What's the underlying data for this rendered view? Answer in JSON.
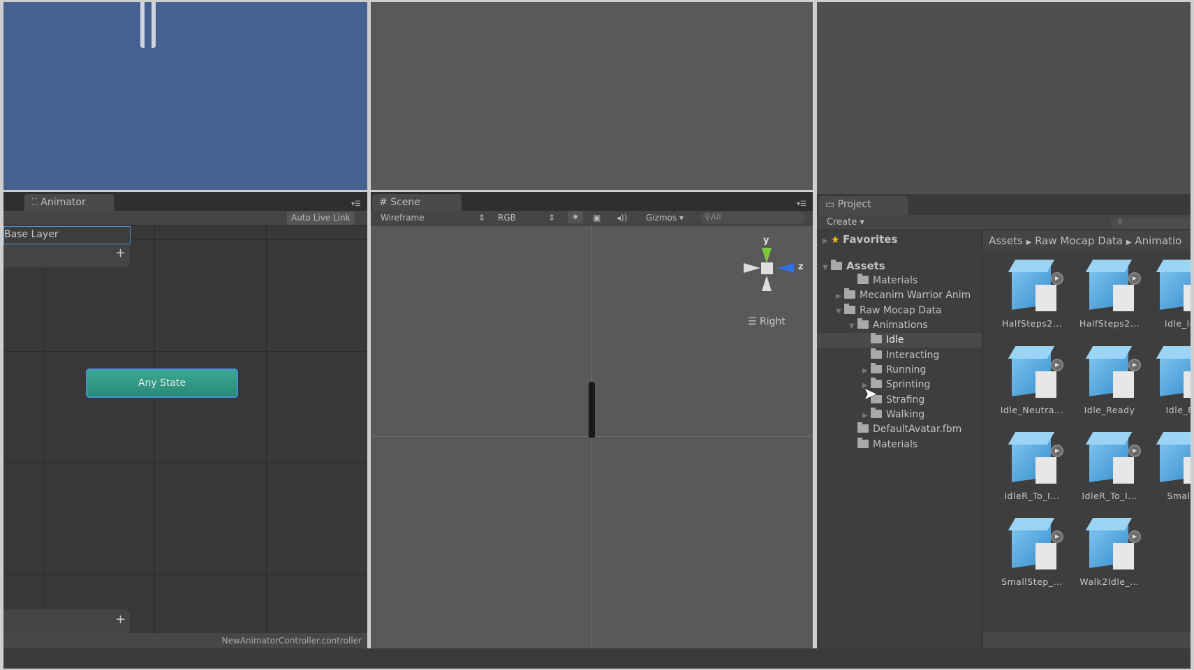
{
  "animator": {
    "tab": "Animator",
    "auto_live_link": "Auto Live Link",
    "layer": "Base Layer",
    "add": "+",
    "state": "Any State",
    "footer": "NewAnimatorController.controller"
  },
  "scene": {
    "tab": "Scene",
    "shading": "Wireframe",
    "channel": "RGB",
    "gizmos": "Gizmos",
    "search": "All",
    "axis_y": "y",
    "axis_z": "z",
    "view": "Right"
  },
  "project": {
    "tab": "Project",
    "create": "Create",
    "breadcrumb": [
      "Assets",
      "Raw Mocap Data",
      "Animatio"
    ],
    "tree": [
      {
        "label": "Favorites",
        "bold": true
      },
      {
        "label": "Assets",
        "bold": true
      },
      {
        "label": "Materials"
      },
      {
        "label": "Mecanim Warrior Anim"
      },
      {
        "label": "Raw Mocap Data"
      },
      {
        "label": "Animations"
      },
      {
        "label": "Idle",
        "selected": true
      },
      {
        "label": "Interacting"
      },
      {
        "label": "Running"
      },
      {
        "label": "Sprinting"
      },
      {
        "label": "Strafing"
      },
      {
        "label": "Walking"
      },
      {
        "label": "DefaultAvatar.fbm"
      },
      {
        "label": "Materials"
      }
    ],
    "assets": [
      "HalfSteps2...",
      "HalfSteps2...",
      "Idle_Id",
      "Idle_Neutra...",
      "Idle_Ready",
      "Idle_R",
      "IdleR_To_I...",
      "IdleR_To_I...",
      "Small",
      "SmallStep_...",
      "Walk2Idle_..."
    ]
  },
  "colors": {
    "preview_bg": "#44618f",
    "any_state": "#2f9a86",
    "selection": "#4a90d9"
  }
}
